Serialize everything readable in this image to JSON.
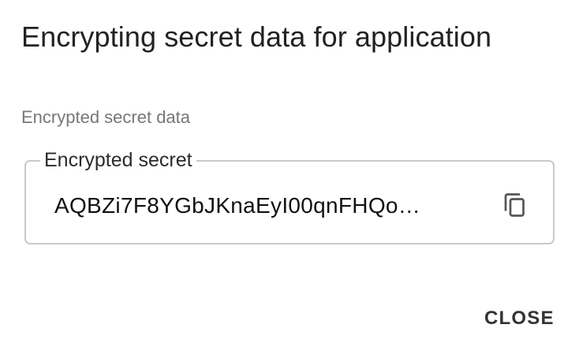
{
  "dialog": {
    "title": "Encrypting secret data for application",
    "section_label": "Encrypted secret data",
    "field": {
      "label": "Encrypted secret",
      "value": "AQBZi7F8YGbJKnaEyI00qnFHQo…",
      "copy_icon": "copy-icon"
    },
    "actions": {
      "close_label": "CLOSE"
    }
  },
  "colors": {
    "title": "#222222",
    "muted_label": "#777777",
    "field_border": "#c9c9c9",
    "icon": "#555555"
  }
}
